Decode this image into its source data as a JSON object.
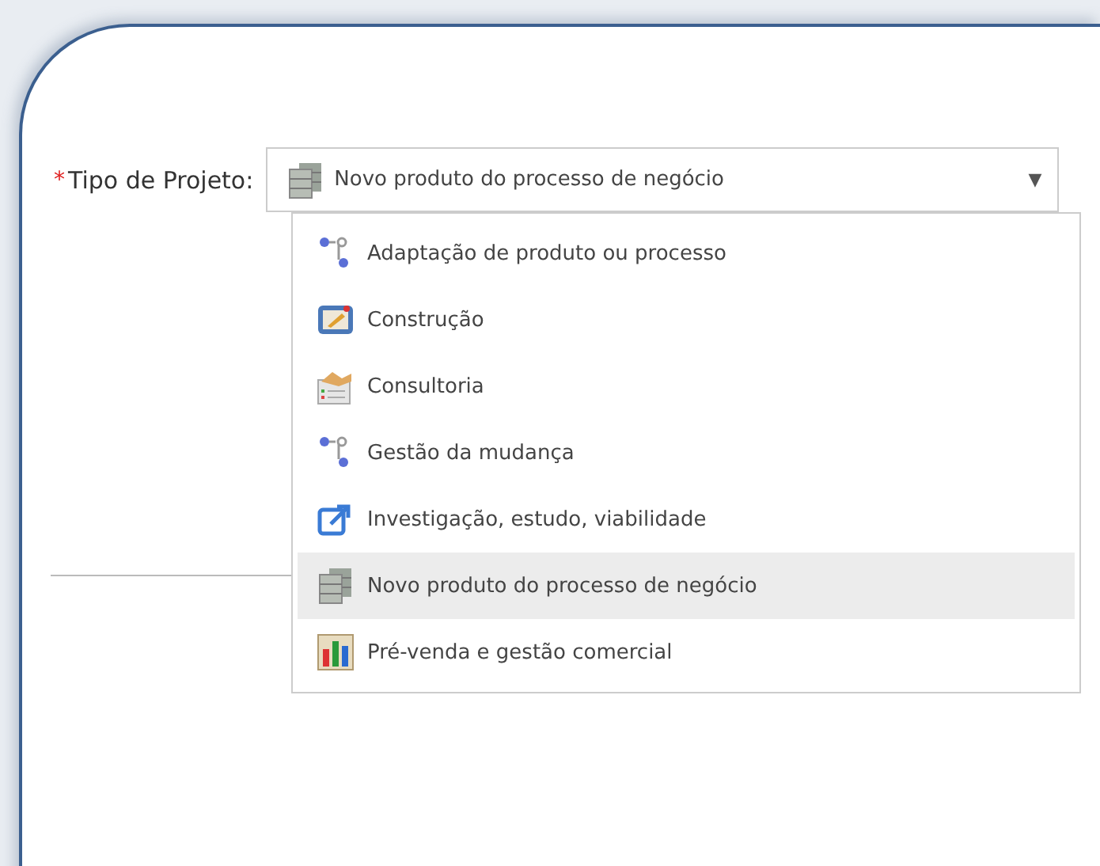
{
  "field": {
    "label": "Tipo de Projeto:",
    "required_mark": "*",
    "value": {
      "text": "Novo produto do processo de negócio",
      "kind": "servers"
    },
    "caret": "▼"
  },
  "options": [
    {
      "label": "Adaptação de produto ou processo",
      "kind": "flow",
      "selected": false
    },
    {
      "label": "Construção",
      "kind": "construction",
      "selected": false
    },
    {
      "label": "Consultoria",
      "kind": "consulting",
      "selected": false
    },
    {
      "label": "Gestão da mudança",
      "kind": "flow",
      "selected": false
    },
    {
      "label": "Investigação, estudo, viabilidade",
      "kind": "external",
      "selected": false
    },
    {
      "label": "Novo produto do processo de negócio",
      "kind": "servers",
      "selected": true
    },
    {
      "label": "Pré-venda e gestão comercial",
      "kind": "chart",
      "selected": false
    }
  ]
}
